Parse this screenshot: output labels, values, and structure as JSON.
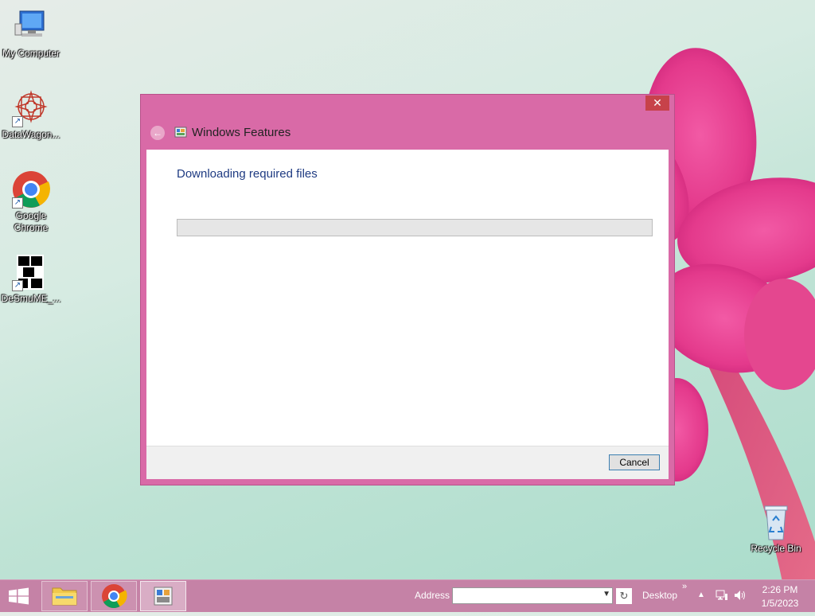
{
  "desktop": {
    "icons": [
      {
        "label": "My Computer",
        "icon": "computer-icon"
      },
      {
        "label": "DataWagon...",
        "icon": "datawagon-icon"
      },
      {
        "label": "Google Chrome",
        "icon": "chrome-icon"
      },
      {
        "label": "DeSmuME_...",
        "icon": "desmume-icon"
      },
      {
        "label": "Recycle Bin",
        "icon": "recycle-bin-icon"
      }
    ]
  },
  "dialog": {
    "title": "Windows Features",
    "close_glyph": "✕",
    "back_glyph": "←",
    "heading": "Downloading required files",
    "progress": 0,
    "cancel_label": "Cancel",
    "accent": "#d96aa7"
  },
  "taskbar": {
    "address_label": "Address",
    "address_value": "",
    "desktop_label": "Desktop",
    "overflow_glyph": "»",
    "tray_up_glyph": "▲",
    "time": "2:26 PM",
    "date": "1/5/2023",
    "color": "#c582a6"
  }
}
